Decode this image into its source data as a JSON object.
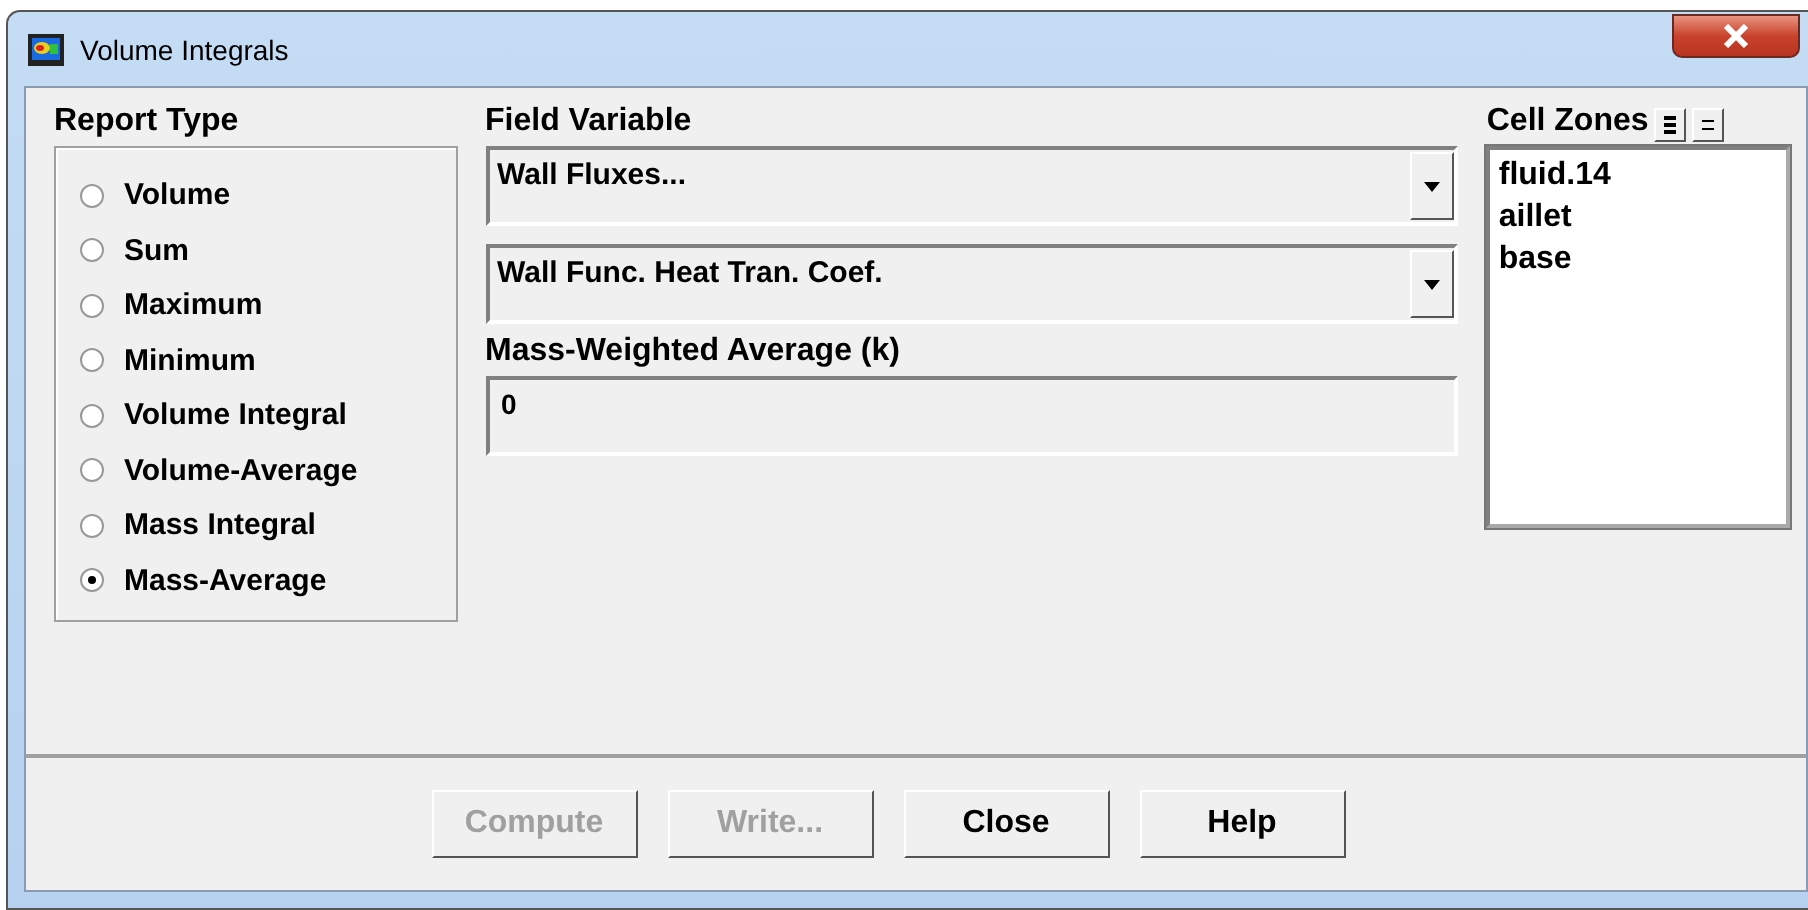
{
  "window": {
    "title": "Volume Integrals"
  },
  "report_type": {
    "label": "Report Type",
    "options": [
      {
        "label": "Volume",
        "selected": false
      },
      {
        "label": "Sum",
        "selected": false
      },
      {
        "label": "Maximum",
        "selected": false
      },
      {
        "label": "Minimum",
        "selected": false
      },
      {
        "label": "Volume Integral",
        "selected": false
      },
      {
        "label": "Volume-Average",
        "selected": false
      },
      {
        "label": "Mass Integral",
        "selected": false
      },
      {
        "label": "Mass-Average",
        "selected": true
      }
    ]
  },
  "field_variable": {
    "label": "Field Variable",
    "category": "Wall Fluxes...",
    "variable": "Wall Func. Heat Tran. Coef."
  },
  "result": {
    "label": "Mass-Weighted Average (k)",
    "value": "0"
  },
  "cell_zones": {
    "label": "Cell Zones",
    "items": [
      "fluid.14",
      "aillet",
      "base"
    ]
  },
  "buttons": [
    {
      "label": "Compute",
      "disabled": true
    },
    {
      "label": "Write...",
      "disabled": true
    },
    {
      "label": "Close",
      "disabled": false
    },
    {
      "label": "Help",
      "disabled": false
    }
  ]
}
